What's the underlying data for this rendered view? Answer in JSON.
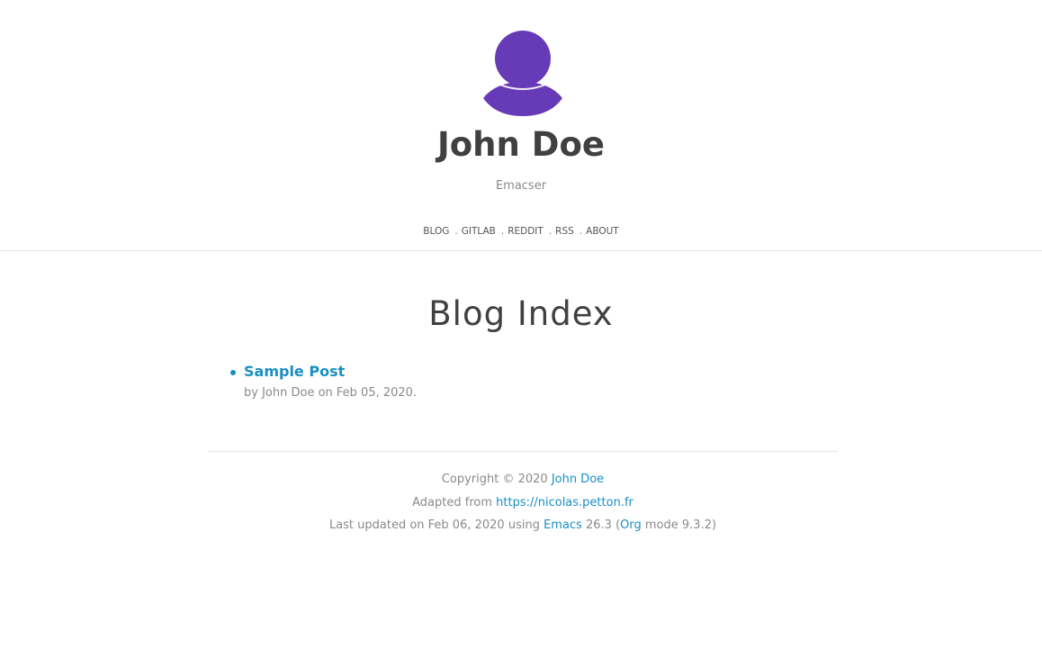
{
  "site": {
    "name": "John Doe",
    "subtitle": "Emacser",
    "avatar_color": "#673ab7"
  },
  "nav": {
    "items": [
      {
        "label": "BLOG"
      },
      {
        "label": "GITLAB"
      },
      {
        "label": "REDDIT"
      },
      {
        "label": "RSS"
      },
      {
        "label": "ABOUT"
      }
    ],
    "separator": "."
  },
  "main": {
    "title": "Blog Index",
    "posts": [
      {
        "title": "Sample Post",
        "meta": "by John Doe on Feb 05, 2020."
      }
    ]
  },
  "footer": {
    "copyright_prefix": "Copyright © 2020",
    "copyright_link": "John Doe",
    "adapted_prefix": "Adapted from",
    "adapted_link": "https://nicolas.petton.fr",
    "updated_prefix": "Last updated on Feb 06, 2020 using",
    "emacs_link": "Emacs",
    "emacs_version": "26.3 (",
    "org_link": "Org",
    "org_suffix": "mode 9.3.2)"
  },
  "colors": {
    "link": "#1a8fc4",
    "heading": "#404040",
    "muted": "#8a8a8a"
  }
}
